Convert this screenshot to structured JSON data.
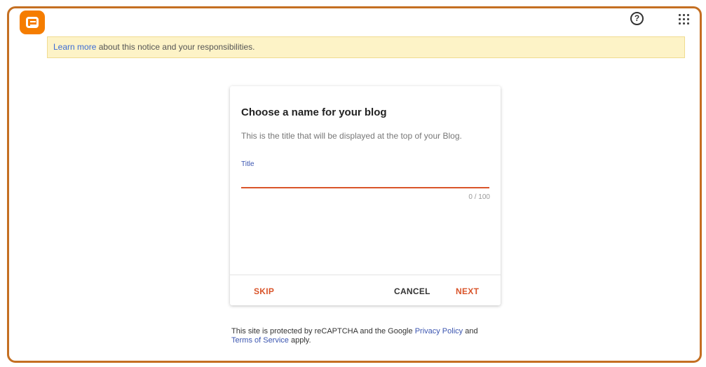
{
  "header": {
    "logo_icon": "blogger-logo",
    "help_icon_glyph": "?",
    "apps_icon": "apps-grid-icon"
  },
  "notice": {
    "link_text": "Learn more",
    "text": " about this notice and your responsibilities."
  },
  "dialog": {
    "title": "Choose a name for your blog",
    "subtitle": "This is the title that will be displayed at the top of your Blog.",
    "field_label": "Title",
    "field_value": "",
    "counter": "0 / 100",
    "buttons": {
      "skip": "SKIP",
      "cancel": "CANCEL",
      "next": "NEXT"
    }
  },
  "footer": {
    "text1": "This site is protected by reCAPTCHA and the Google ",
    "privacy_link": "Privacy Policy",
    "text2": " and",
    "terms_link": "Terms of Service",
    "text3": " apply."
  },
  "colors": {
    "brand": "#f57d00",
    "accent": "#d9542a",
    "link": "#3b55b0",
    "notice_bg": "#fdf3c7"
  }
}
